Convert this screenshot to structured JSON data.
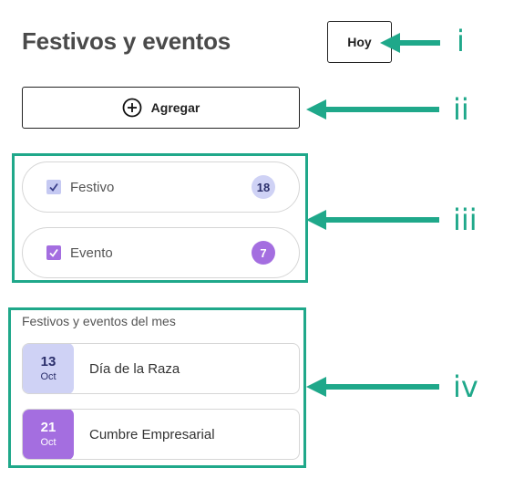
{
  "header": {
    "title": "Festivos y eventos",
    "today_label": "Hoy"
  },
  "add_button": {
    "label": "Agregar",
    "icon": "plus-circle-icon"
  },
  "filters": [
    {
      "label": "Festivo",
      "count": "18",
      "checked": true,
      "checkbox_color": "#c5c9f2",
      "check_color": "#3b3f8a",
      "badge_bg": "#cfd2f5",
      "badge_text": "#2b2f6b"
    },
    {
      "label": "Evento",
      "count": "7",
      "checked": true,
      "checkbox_color": "#a46ee0",
      "check_color": "#ffffff",
      "badge_bg": "#a46ee0",
      "badge_text": "#ffffff"
    }
  ],
  "month_section": {
    "title": "Festivos y eventos del mes",
    "events": [
      {
        "day": "13",
        "month": "Oct",
        "name": "Día de la Raza",
        "color": "#cfd2f5",
        "text_color": "#2b2f6b"
      },
      {
        "day": "21",
        "month": "Oct",
        "name": "Cumbre Empresarial",
        "color": "#a46ee0",
        "text_color": "#ffffff"
      }
    ]
  },
  "callouts": [
    "i",
    "ii",
    "iii",
    "iv"
  ],
  "colors": {
    "annotation": "#1fa88a"
  }
}
